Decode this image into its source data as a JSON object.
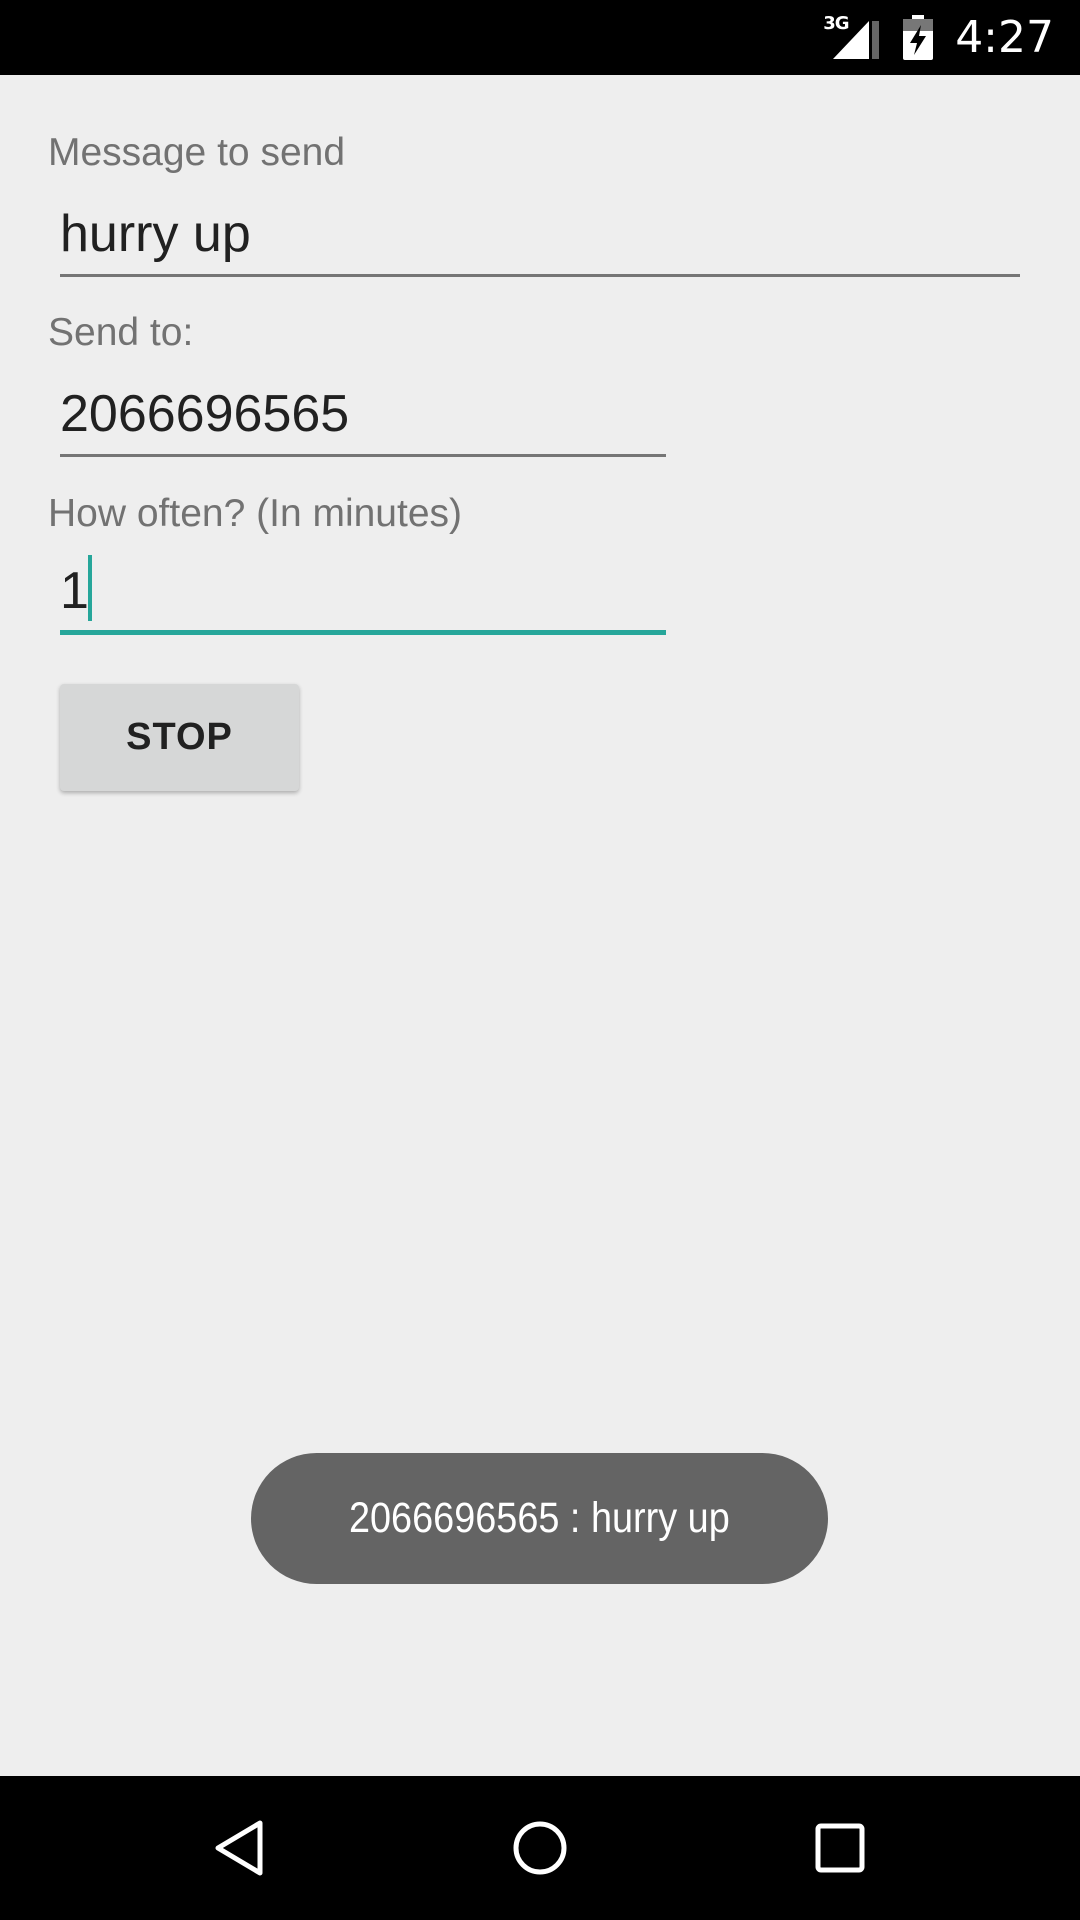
{
  "status_bar": {
    "network_type": "3G",
    "time": "4:27",
    "icons": [
      "signal-icon",
      "battery-charging-icon"
    ]
  },
  "form": {
    "message_label": "Message to send",
    "message_value": "hurry up",
    "send_to_label": "Send to:",
    "send_to_value": "2066696565",
    "interval_label": "How often? (In minutes)",
    "interval_value": "1",
    "stop_button_label": "STOP"
  },
  "toast": {
    "text": "2066696565 : hurry up"
  },
  "nav_bar": {
    "icons": [
      "back-icon",
      "home-icon",
      "recents-icon"
    ]
  },
  "colors": {
    "accent": "#26a69a",
    "background": "#eeeeee",
    "toast_background": "#646464"
  }
}
